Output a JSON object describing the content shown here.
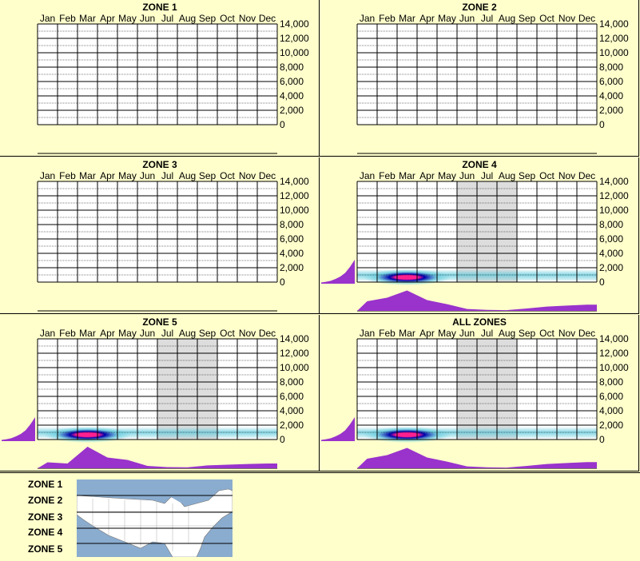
{
  "months": [
    "Jan",
    "Feb",
    "Mar",
    "Apr",
    "May",
    "Jun",
    "Jul",
    "Aug",
    "Sep",
    "Oct",
    "Nov",
    "Dec"
  ],
  "y_ticks": [
    "14,000",
    "12,000",
    "10,000",
    "8,000",
    "6,000",
    "4,000",
    "2,000",
    "0"
  ],
  "colors": {
    "background": "#ffffcc",
    "purple": "#9933cc",
    "shade": "#dddddd",
    "hot": "#ff2090",
    "dark_blue": "#0000aa",
    "cyan": "#66ccdd",
    "map_water": "#8aaccf",
    "map_land": "#ffffff"
  },
  "legend": {
    "zones": [
      "ZONE 1",
      "ZONE 2",
      "ZONE 3",
      "ZONE 4",
      "ZONE 5"
    ]
  },
  "chart_data": [
    {
      "type": "heatmap",
      "title": "ZONE 1",
      "x": [
        "Jan",
        "Feb",
        "Mar",
        "Apr",
        "May",
        "Jun",
        "Jul",
        "Aug",
        "Sep",
        "Oct",
        "Nov",
        "Dec"
      ],
      "ylim": [
        0,
        14000
      ],
      "has_data": false
    },
    {
      "type": "heatmap",
      "title": "ZONE 2",
      "x": [
        "Jan",
        "Feb",
        "Mar",
        "Apr",
        "May",
        "Jun",
        "Jul",
        "Aug",
        "Sep",
        "Oct",
        "Nov",
        "Dec"
      ],
      "ylim": [
        0,
        14000
      ],
      "has_data": false
    },
    {
      "type": "heatmap",
      "title": "ZONE 3",
      "x": [
        "Jan",
        "Feb",
        "Mar",
        "Apr",
        "May",
        "Jun",
        "Jul",
        "Aug",
        "Sep",
        "Oct",
        "Nov",
        "Dec"
      ],
      "ylim": [
        0,
        14000
      ],
      "has_data": false
    },
    {
      "type": "heatmap",
      "title": "ZONE 4",
      "x": [
        "Jan",
        "Feb",
        "Mar",
        "Apr",
        "May",
        "Jun",
        "Jul",
        "Aug",
        "Sep",
        "Oct",
        "Nov",
        "Dec"
      ],
      "ylim": [
        0,
        14000
      ],
      "has_data": true,
      "shaded_months": [
        "Jun",
        "Jul",
        "Aug"
      ],
      "monthly_profile": [
        0.4,
        0.55,
        0.85,
        0.45,
        0.28,
        0.08,
        0.04,
        0.03,
        0.1,
        0.18,
        0.22,
        0.26
      ],
      "elevation_profile": [
        0.05,
        0.08,
        0.12,
        0.2,
        0.3,
        0.45,
        0.7,
        1.0
      ]
    },
    {
      "type": "heatmap",
      "title": "ZONE 5",
      "x": [
        "Jan",
        "Feb",
        "Mar",
        "Apr",
        "May",
        "Jun",
        "Jul",
        "Aug",
        "Sep",
        "Oct",
        "Nov",
        "Dec"
      ],
      "ylim": [
        0,
        14000
      ],
      "has_data": true,
      "shaded_months": [
        "Jul",
        "Aug",
        "Sep"
      ],
      "monthly_profile": [
        0.25,
        0.2,
        0.9,
        0.45,
        0.35,
        0.1,
        0.05,
        0.04,
        0.12,
        0.15,
        0.18,
        0.2
      ],
      "elevation_profile": [
        0.05,
        0.08,
        0.12,
        0.2,
        0.3,
        0.45,
        0.7,
        1.0
      ]
    },
    {
      "type": "heatmap",
      "title": "ALL ZONES",
      "x": [
        "Jan",
        "Feb",
        "Mar",
        "Apr",
        "May",
        "Jun",
        "Jul",
        "Aug",
        "Sep",
        "Oct",
        "Nov",
        "Dec"
      ],
      "ylim": [
        0,
        14000
      ],
      "has_data": true,
      "shaded_months": [
        "Jun",
        "Jul",
        "Aug"
      ],
      "monthly_profile": [
        0.4,
        0.55,
        0.85,
        0.45,
        0.28,
        0.08,
        0.04,
        0.03,
        0.1,
        0.18,
        0.22,
        0.26
      ],
      "elevation_profile": [
        0.05,
        0.08,
        0.12,
        0.2,
        0.3,
        0.45,
        0.7,
        1.0
      ]
    }
  ]
}
